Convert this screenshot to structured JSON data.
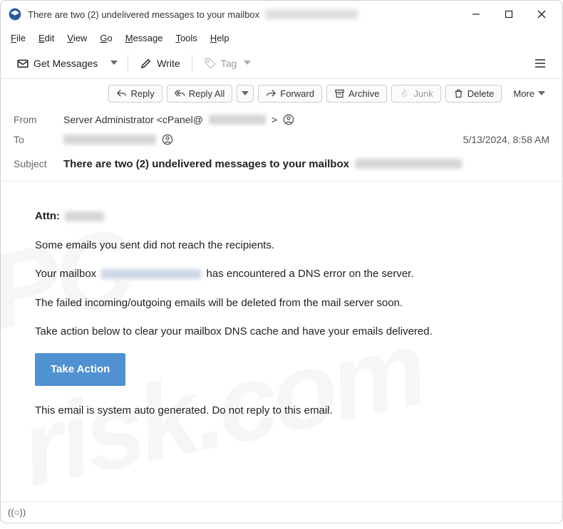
{
  "window": {
    "title": "There are two (2) undelivered messages to your mailbox"
  },
  "menubar": [
    "File",
    "Edit",
    "View",
    "Go",
    "Message",
    "Tools",
    "Help"
  ],
  "toolbar": {
    "get_messages": "Get Messages",
    "write": "Write",
    "tag": "Tag"
  },
  "actions": {
    "reply": "Reply",
    "reply_all": "Reply All",
    "forward": "Forward",
    "archive": "Archive",
    "junk": "Junk",
    "delete": "Delete",
    "more": "More"
  },
  "headers": {
    "from_label": "From",
    "from_value": "Server Administrator <cPanel@",
    "from_suffix": " >",
    "to_label": "To",
    "subject_label": "Subject",
    "subject_value": "There are two (2) undelivered messages to your mailbox",
    "date": "5/13/2024, 8:58 AM"
  },
  "body": {
    "attn_label": "Attn:",
    "p1": "Some emails you sent did not reach the recipients.",
    "p2a": "Your mailbox",
    "p2b": "has encountered a DNS error on the server.",
    "p3": "The failed incoming/outgoing emails will be deleted from the mail server soon.",
    "p4": "Take action below to clear your mailbox DNS cache and have your emails delivered.",
    "cta": "Take Action",
    "footer": "This email is system auto generated. Do not reply to this email."
  },
  "status": {
    "net": "((○))"
  }
}
